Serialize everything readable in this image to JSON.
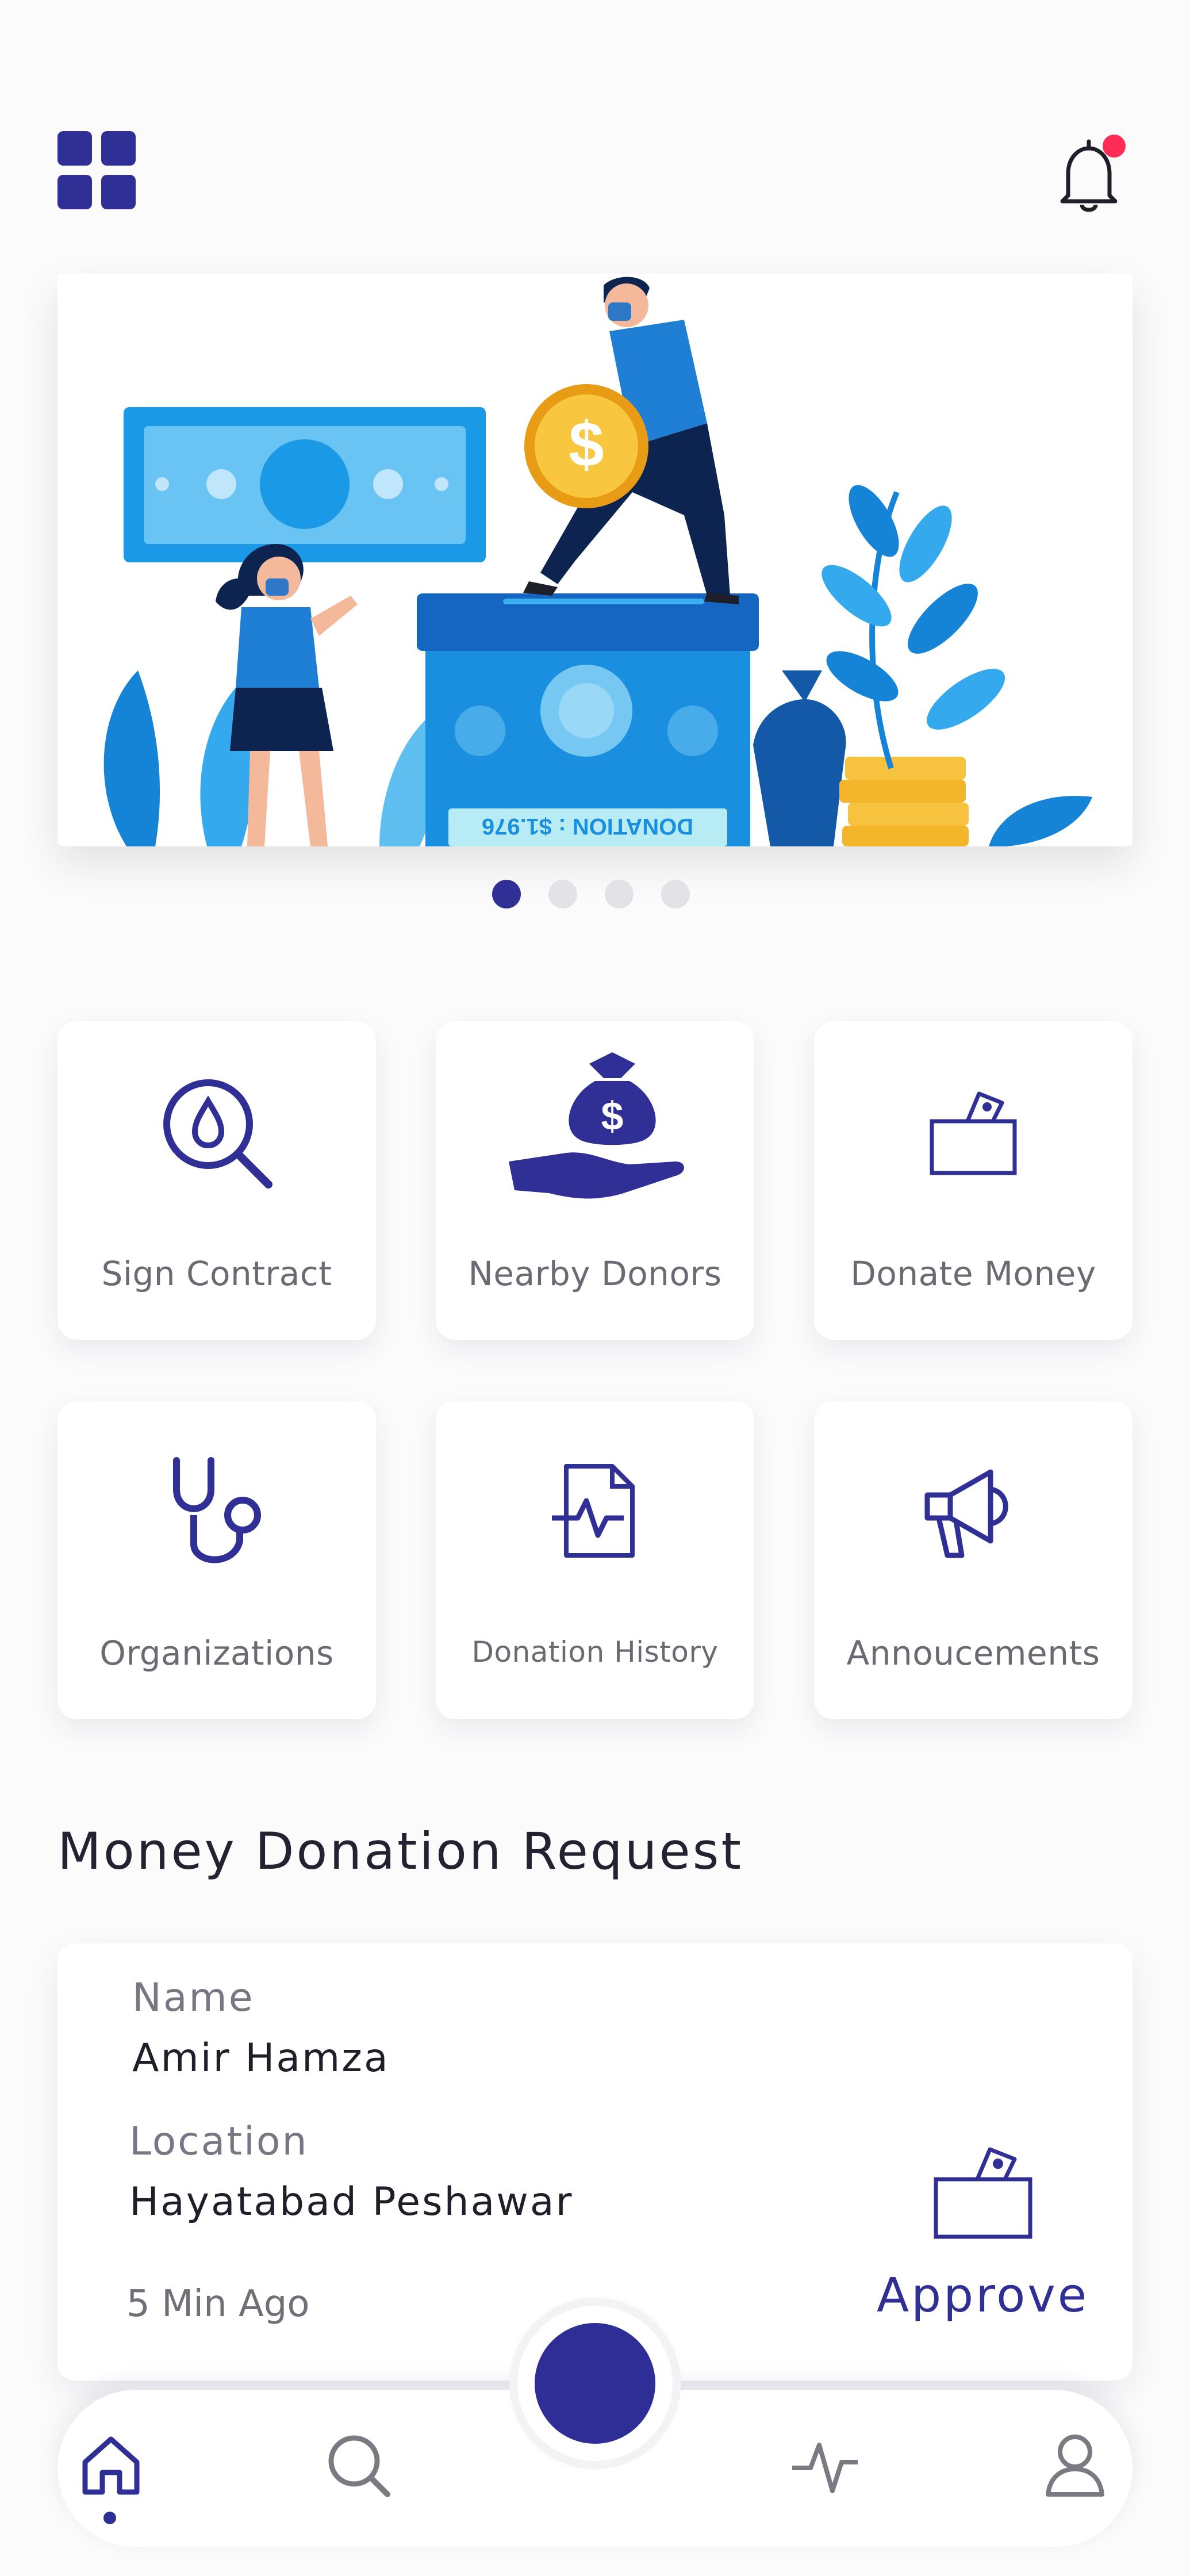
{
  "header": {
    "menu_icon": "grid-icon",
    "notification_icon": "bell-icon",
    "notification_badge_color": "#ff2d55"
  },
  "banner": {
    "donation_box_text": "DONATION : $1.976",
    "carousel": {
      "pages": 4,
      "active_index": 0
    }
  },
  "tiles": [
    {
      "label": "Sign Contract",
      "icon": "blood-search-icon"
    },
    {
      "label": "Nearby Donors",
      "icon": "hand-money-bag-icon"
    },
    {
      "label": "Donate Money",
      "icon": "donation-box-icon"
    },
    {
      "label": "Organizations",
      "icon": "stethoscope-icon"
    },
    {
      "label": "Donation History",
      "icon": "medical-report-icon"
    },
    {
      "label": "Annoucements",
      "icon": "megaphone-icon"
    }
  ],
  "section": {
    "title": "Money Donation Request"
  },
  "request": {
    "name_label": "Name",
    "name": "Amir Hamza",
    "location_label": "Location",
    "location": "Hayatabad Peshawar",
    "time": "5 Min Ago",
    "approve_label": "Approve"
  },
  "nav": {
    "items": [
      "home-icon",
      "search-icon",
      "activity-icon",
      "profile-icon"
    ],
    "active": "home-icon"
  },
  "colors": {
    "accent": "#2f2f96",
    "banner_blue": "#1b8fe0",
    "gold": "#f7c23d"
  }
}
